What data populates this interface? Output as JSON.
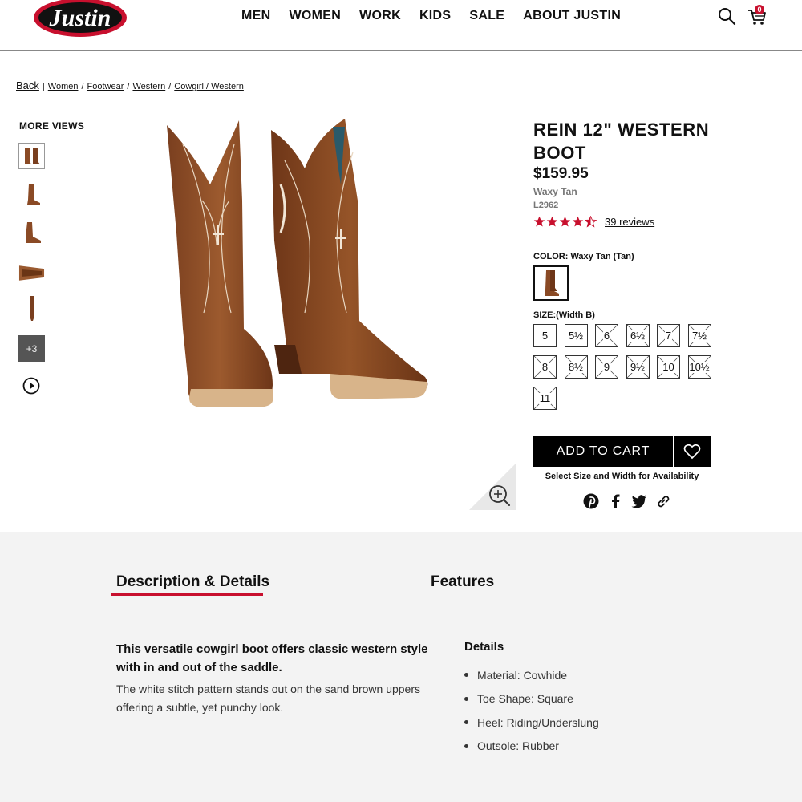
{
  "header": {
    "logo_text": "Justin",
    "nav": [
      "MEN",
      "WOMEN",
      "WORK",
      "KIDS",
      "SALE",
      "ABOUT JUSTIN"
    ],
    "cart_count": "0",
    "search_icon": "search-icon",
    "cart_icon": "cart-icon"
  },
  "breadcrumb": {
    "back": "Back",
    "items": [
      "Women",
      "Footwear",
      "Western",
      "Cowgirl / Western"
    ]
  },
  "more_views": {
    "title": "MORE VIEWS",
    "more_label": "+3"
  },
  "product": {
    "title": "REIN 12\" WESTERN BOOT",
    "price": "$159.95",
    "color_name": "Waxy Tan",
    "sku": "L2962",
    "rating": 4.5,
    "reviews": "39 reviews",
    "color_label": "COLOR: Waxy Tan (Tan)",
    "size_label": "SIZE:(Width B)",
    "sizes": [
      {
        "label": "5",
        "available": true
      },
      {
        "label": "5½",
        "available": true
      },
      {
        "label": "6",
        "available": false
      },
      {
        "label": "6½",
        "available": false
      },
      {
        "label": "7",
        "available": false
      },
      {
        "label": "7½",
        "available": false
      },
      {
        "label": "8",
        "available": false
      },
      {
        "label": "8½",
        "available": false
      },
      {
        "label": "9",
        "available": false
      },
      {
        "label": "9½",
        "available": false
      },
      {
        "label": "10",
        "available": false
      },
      {
        "label": "10½",
        "available": false
      },
      {
        "label": "11",
        "available": false
      }
    ],
    "add_to_cart": "ADD TO CART",
    "availability_note": "Select Size and Width for Availability"
  },
  "colors": {
    "accent": "#c8102e",
    "boot_brown": "#8a4a25",
    "section_bg": "#f3f3f3"
  },
  "details": {
    "tab_description": "Description & Details",
    "tab_features": "Features",
    "headline": "This versatile cowgirl boot offers classic western style with in and out of the saddle.",
    "body": "The white stitch pattern stands out on the sand brown uppers offering a subtle, yet punchy look.",
    "features_title": "Details",
    "features": [
      "Material: Cowhide",
      "Toe Shape: Square",
      "Heel: Riding/Underslung",
      "Outsole: Rubber"
    ]
  }
}
